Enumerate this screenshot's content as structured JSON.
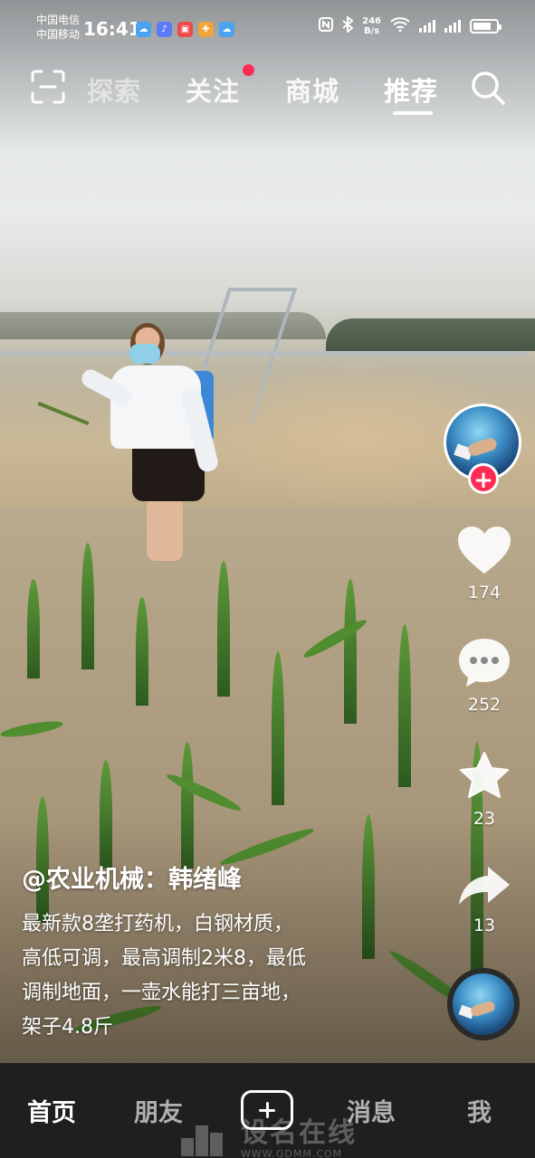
{
  "status_bar": {
    "carrier_1": "中国电信",
    "carrier_2": "中国移动",
    "time": "16:41",
    "net_speed_value": "246",
    "net_speed_unit": "B/s",
    "battery_percent": 80
  },
  "top_nav": {
    "tabs": [
      {
        "label": "探索"
      },
      {
        "label": "关注"
      },
      {
        "label": "商城"
      },
      {
        "label": "推荐"
      }
    ],
    "active_tab": "推荐",
    "follow_has_notification": true,
    "icons": {
      "left": "scan-icon",
      "right": "search-icon"
    }
  },
  "actions": {
    "likes": "174",
    "comments": "252",
    "favorites": "23",
    "shares": "13",
    "follow_symbol": "+"
  },
  "caption": {
    "author": "@农业机械：韩绪峰",
    "lines": [
      "最新款8垄打药机，白钢材质，",
      "高低可调，最高调制2米8，最低",
      "调制地面，一壶水能打三亩地，",
      "架子4.8斤"
    ]
  },
  "tab_bar": {
    "items": [
      {
        "label": "首页"
      },
      {
        "label": "朋友"
      },
      {
        "label": "消息"
      },
      {
        "label": "我"
      }
    ],
    "active": "首页",
    "create_icon": "plus-icon"
  },
  "watermark": {
    "text": "设名在线",
    "url": "WWW.GDMM.COM"
  },
  "colors": {
    "accent_red": "#fe2c55",
    "tab_bar_bg": "#1f1f1f"
  }
}
